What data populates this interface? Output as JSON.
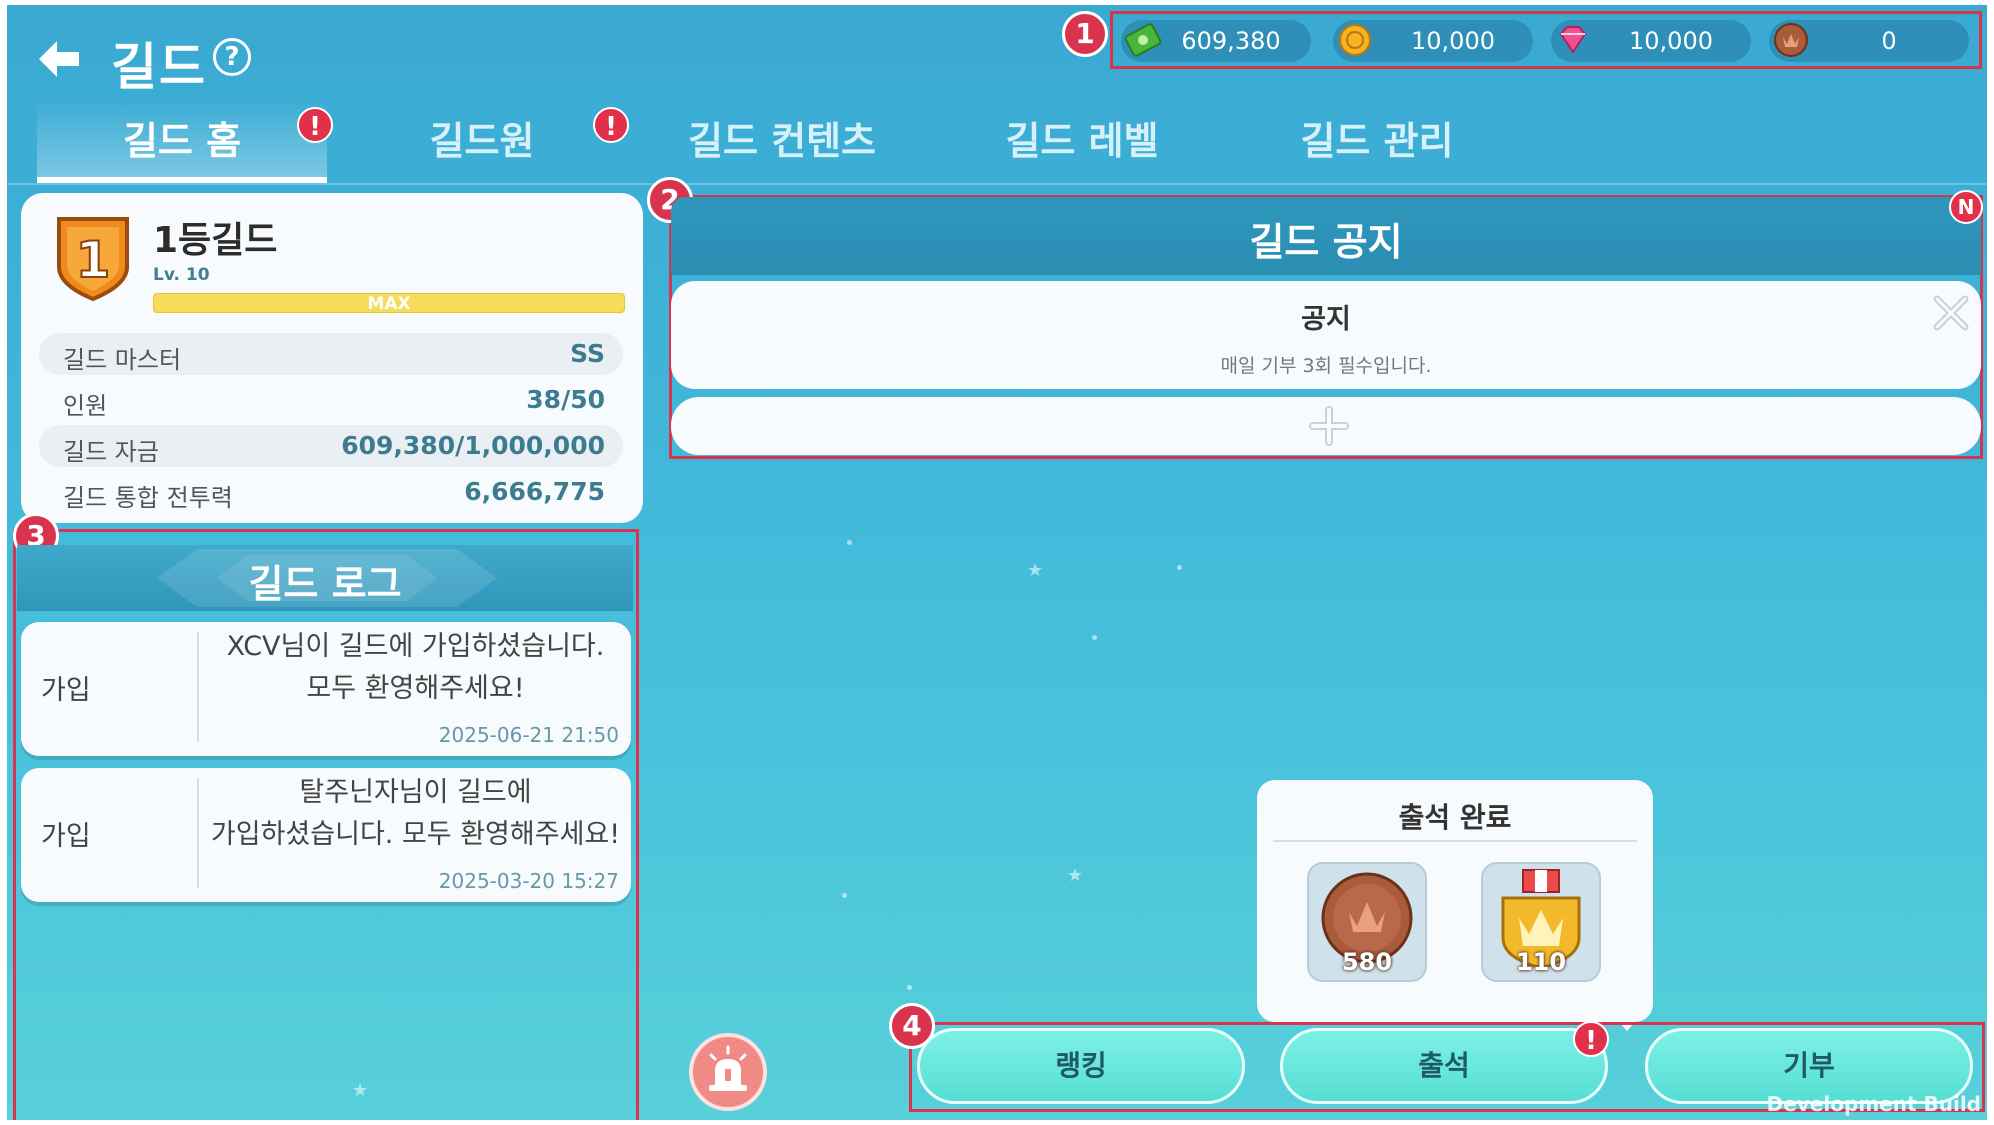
{
  "header": {
    "title": "길드",
    "help_label": "?"
  },
  "currency": [
    {
      "icon": "cash-icon",
      "value": "609,380"
    },
    {
      "icon": "gold-coin-icon",
      "value": "10,000"
    },
    {
      "icon": "gem-icon",
      "value": "10,000"
    },
    {
      "icon": "bronze-medal-icon",
      "value": "0"
    }
  ],
  "tabs": [
    {
      "label": "길드 홈",
      "active": true,
      "alert": "!"
    },
    {
      "label": "길드원",
      "active": false,
      "alert": "!"
    },
    {
      "label": "길드 컨텐츠",
      "active": false
    },
    {
      "label": "길드 레벨",
      "active": false
    },
    {
      "label": "길드 관리",
      "active": false
    }
  ],
  "guild": {
    "rank": "1",
    "name": "1등길드",
    "level": "Lv. 10",
    "level_bar_label": "MAX",
    "level_progress": 1.0,
    "rows": [
      {
        "key": "길드 마스터",
        "value": "SS"
      },
      {
        "key": "인원",
        "value": "38/50"
      },
      {
        "key": "길드 자금",
        "value": "609,380/1,000,000"
      },
      {
        "key": "길드 통합 전투력",
        "value": "6,666,775"
      }
    ]
  },
  "log": {
    "title": "길드 로그",
    "entries": [
      {
        "type": "가입",
        "line1": "XCV님이 길드에 가입하셨습니다.",
        "line2": "모두 환영해주세요!",
        "time": "2025-06-21 21:50"
      },
      {
        "type": "가입",
        "line1": "탈주닌자님이 길드에",
        "line2": "가입하셨습니다. 모두 환영해주세요!",
        "time": "2025-03-20 15:27"
      }
    ]
  },
  "notice": {
    "title": "길드 공지",
    "new_badge": "N",
    "item_title": "공지",
    "item_body": "매일 기부 3회 필수입니다."
  },
  "attendance": {
    "title": "출석 완료",
    "rewards": [
      {
        "icon": "bronze-medal-icon",
        "count": "580"
      },
      {
        "icon": "gold-medal-icon",
        "count": "110"
      }
    ]
  },
  "buttons": {
    "ranking": "랭킹",
    "attendance": "출석",
    "attendance_alert": "!",
    "donate": "기부"
  },
  "callouts": [
    "1",
    "2",
    "3",
    "4"
  ],
  "watermark": "Development Build",
  "colors": {
    "callout": "#d8344e",
    "alert": "#e0304a",
    "button": "#5fe3d7"
  }
}
